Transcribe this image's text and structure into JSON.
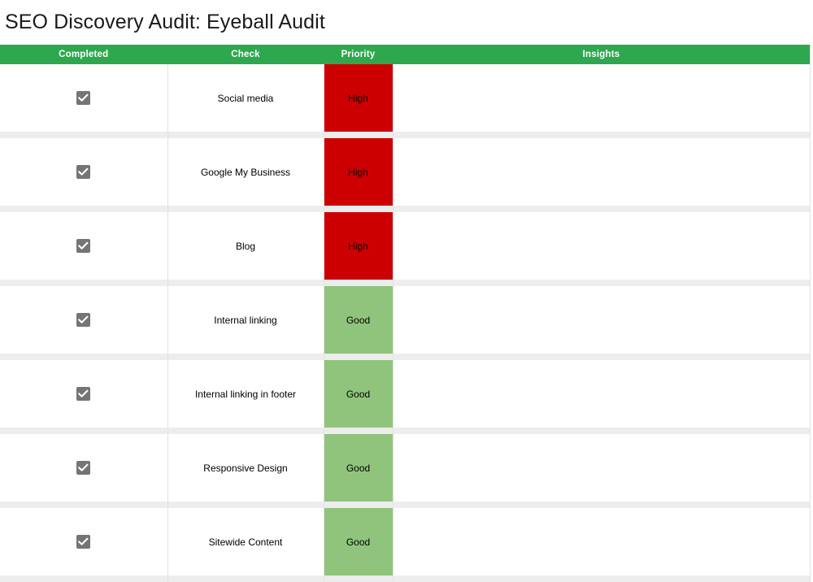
{
  "document": {
    "title": "SEO Discovery Audit: Eyeball Audit"
  },
  "table": {
    "columns": [
      {
        "key": "completed",
        "label": "Completed"
      },
      {
        "key": "check",
        "label": "Check"
      },
      {
        "key": "priority",
        "label": "Priority"
      },
      {
        "key": "insights",
        "label": "Insights"
      }
    ],
    "colors": {
      "header_green": "#2da84e",
      "priority_high": "#cc0000",
      "priority_good": "#90c47c",
      "row_separator": "#ededed",
      "grid_line": "#e2e2e2",
      "checkbox_fill": "#757575"
    },
    "rows": [
      {
        "completed": true,
        "completed_icon": "checkbox-checked-icon",
        "check": "Social media",
        "priority": "High",
        "priority_state": "high",
        "insights": ""
      },
      {
        "completed": true,
        "completed_icon": "checkbox-checked-icon",
        "check": "Google My Business",
        "priority": "High",
        "priority_state": "high",
        "insights": ""
      },
      {
        "completed": true,
        "completed_icon": "checkbox-checked-icon",
        "check": "Blog",
        "priority": "High",
        "priority_state": "high",
        "insights": ""
      },
      {
        "completed": true,
        "completed_icon": "checkbox-checked-icon",
        "check": "Internal linking",
        "priority": "Good",
        "priority_state": "good",
        "insights": ""
      },
      {
        "completed": true,
        "completed_icon": "checkbox-checked-icon",
        "check": "Internal linking in footer",
        "priority": "Good",
        "priority_state": "good",
        "insights": ""
      },
      {
        "completed": true,
        "completed_icon": "checkbox-checked-icon",
        "check": "Responsive Design",
        "priority": "Good",
        "priority_state": "good",
        "insights": ""
      },
      {
        "completed": true,
        "completed_icon": "checkbox-checked-icon",
        "check": "Sitewide Content",
        "priority": "Good",
        "priority_state": "good",
        "insights": ""
      }
    ]
  }
}
